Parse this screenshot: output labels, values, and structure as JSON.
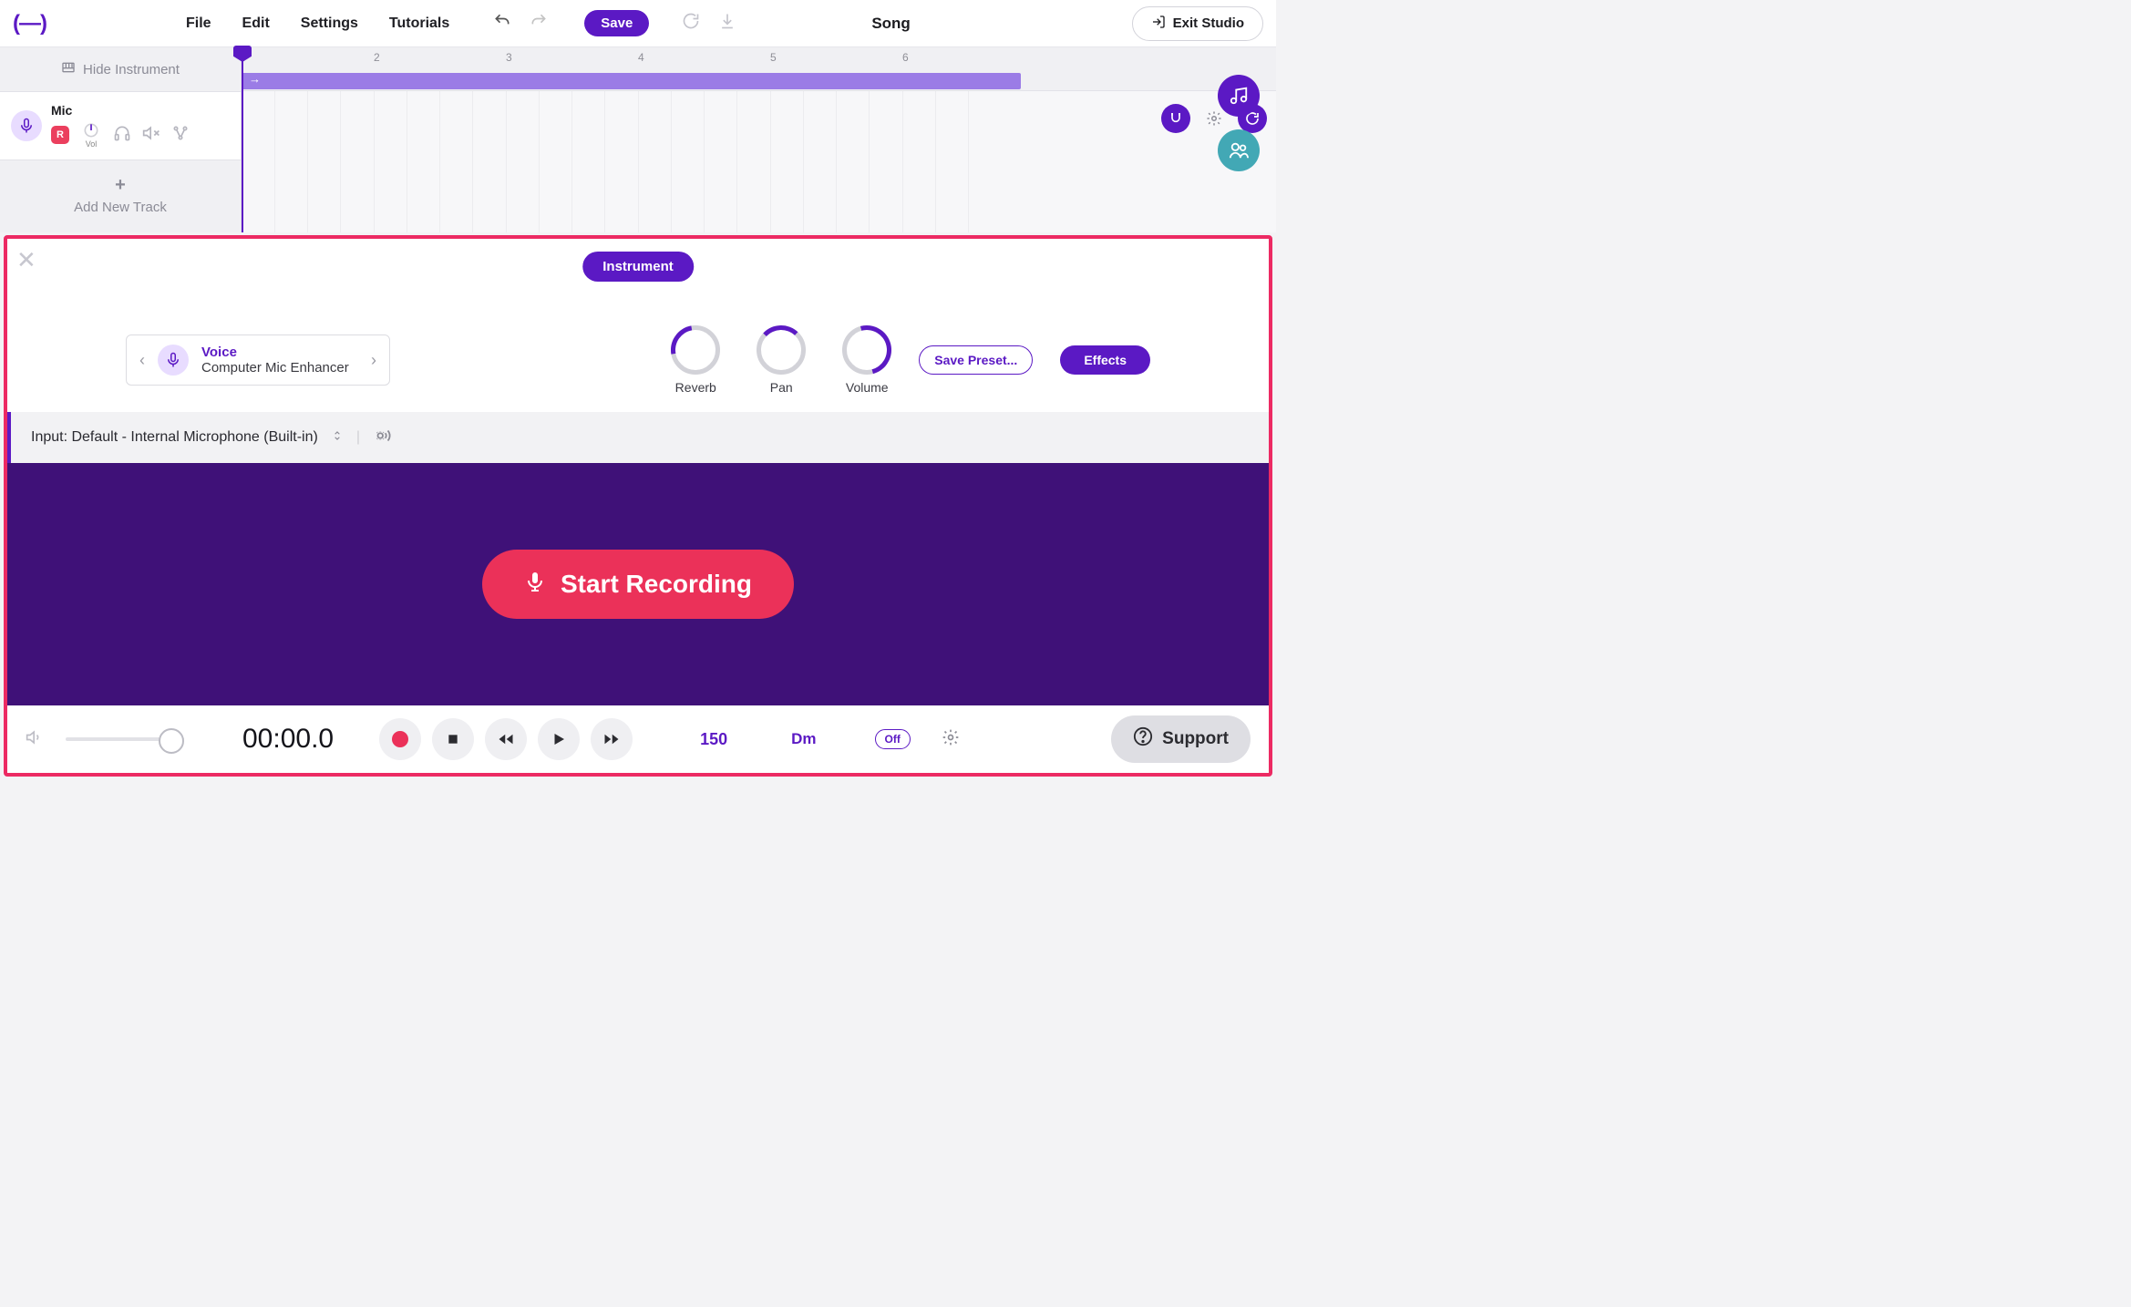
{
  "menu": {
    "file": "File",
    "edit": "Edit",
    "settings": "Settings",
    "tutorials": "Tutorials",
    "save": "Save",
    "song_title": "Song",
    "exit": "Exit Studio"
  },
  "sidebar": {
    "hide": "Hide Instrument",
    "track_name": "Mic",
    "rec_label": "R",
    "vol_label": "Vol",
    "add_track": "Add New Track"
  },
  "ruler": {
    "m2": "2",
    "m3": "3",
    "m4": "4",
    "m5": "5",
    "m6": "6"
  },
  "panel": {
    "tab": "Instrument",
    "instr_name": "Voice",
    "instr_sub": "Computer Mic Enhancer",
    "reverb": "Reverb",
    "pan": "Pan",
    "volume": "Volume",
    "save_preset": "Save Preset...",
    "effects": "Effects",
    "input_label": "Input: Default - Internal Microphone (Built-in)",
    "start_rec": "Start Recording"
  },
  "transport": {
    "time": "00:00.0",
    "tempo": "150",
    "key": "Dm",
    "off": "Off",
    "support": "Support"
  }
}
